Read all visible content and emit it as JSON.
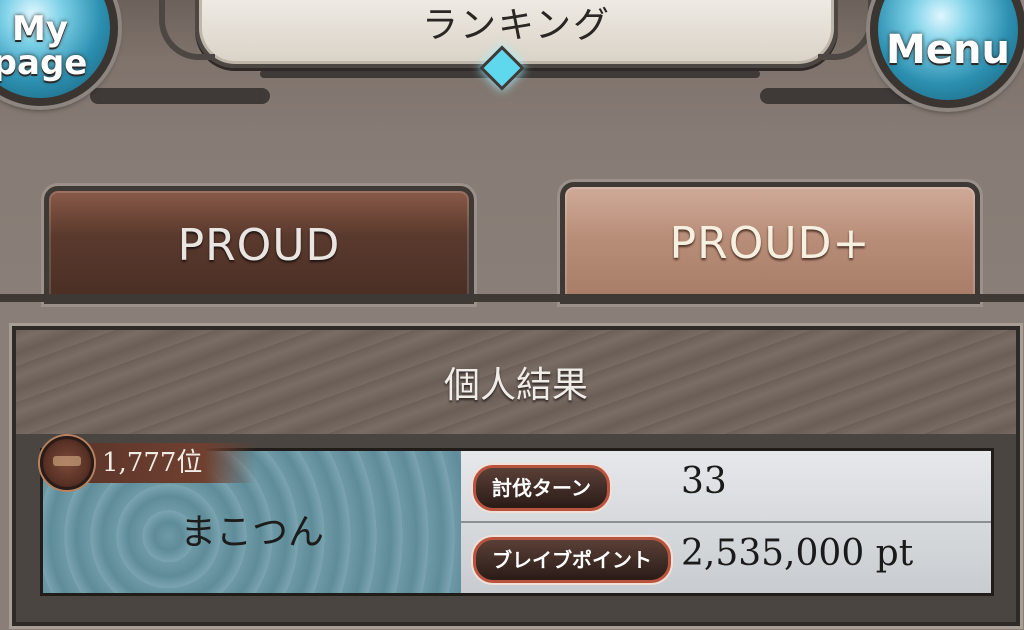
{
  "header": {
    "title": "ランキング",
    "mypage_line1": "My",
    "mypage_line2": "page",
    "menu_label": "Menu"
  },
  "tabs": [
    {
      "label": "PROUD",
      "selected": false
    },
    {
      "label": "PROUD+",
      "selected": true
    }
  ],
  "panel": {
    "title": "個人結果",
    "rank": "1,777位",
    "player_name": "まこつん",
    "stats": [
      {
        "label": "討伐ターン",
        "value": "33"
      },
      {
        "label": "ブレイブポイント",
        "value": "2,535,000 pt"
      }
    ]
  },
  "colors": {
    "accent_cyan": "#5fd8ee",
    "tab_selected": "#b98e79",
    "tab_unselected": "#5b3a2e",
    "badge_border": "#b8543e"
  }
}
